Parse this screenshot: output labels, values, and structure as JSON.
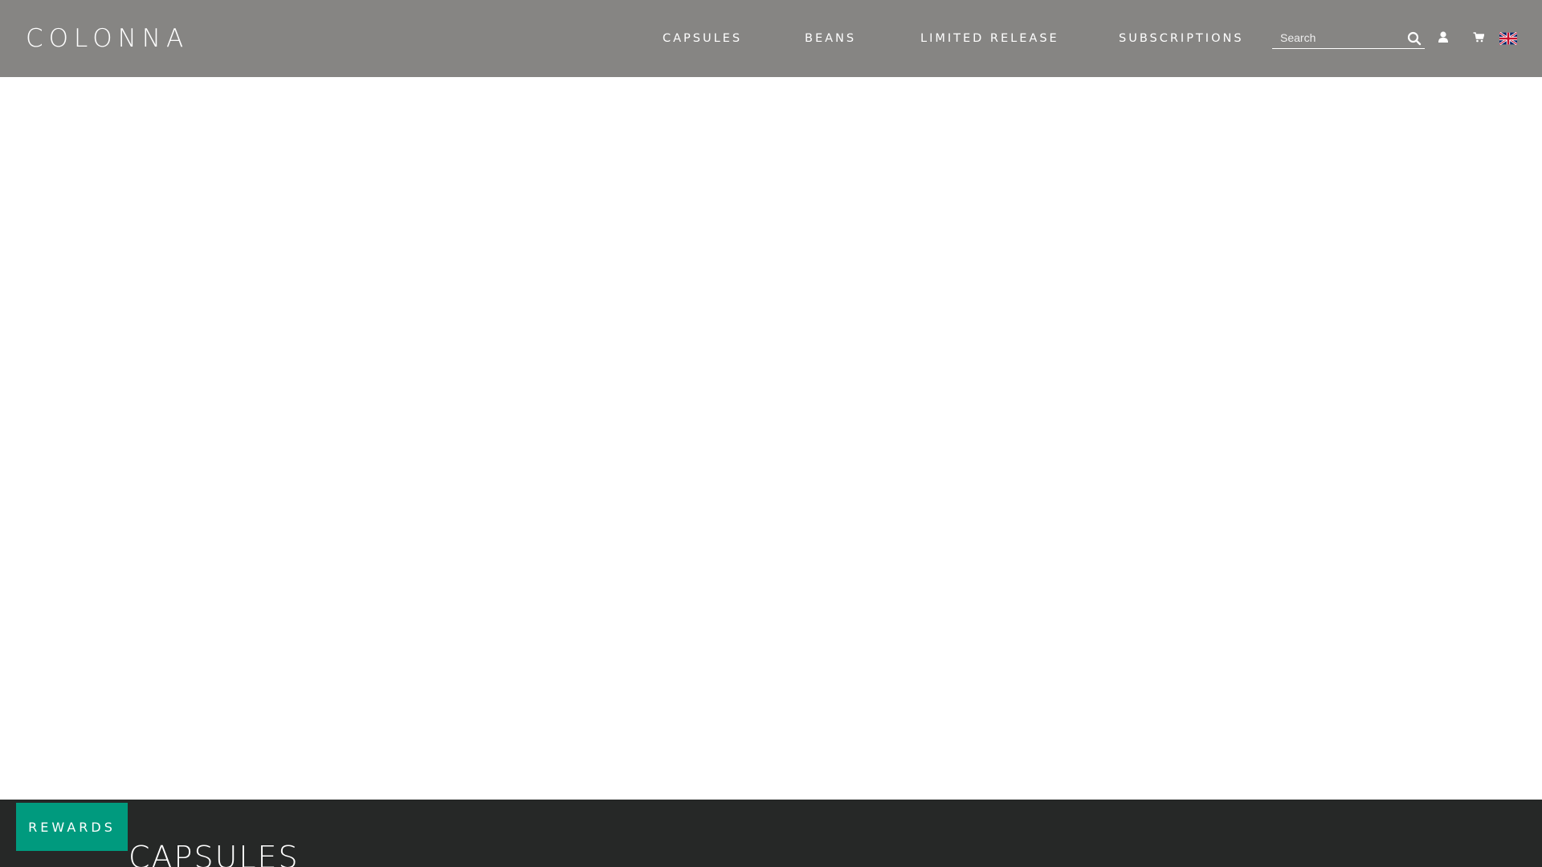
{
  "header": {
    "logo": "COLONNA",
    "nav": [
      {
        "label": "CAPSULES"
      },
      {
        "label": "BEANS"
      },
      {
        "label": "LIMITED RELEASE"
      },
      {
        "label": "SUBSCRIPTIONS"
      }
    ],
    "search": {
      "placeholder": "Search",
      "value": ""
    },
    "icons": {
      "search": "search-icon",
      "account": "user-icon",
      "cart": "cart-icon",
      "language": "uk-flag-icon"
    }
  },
  "rewards_button": {
    "label": "REWARDS"
  },
  "section": {
    "title": "CAPSULES"
  },
  "colors": {
    "header_bg": "#868583",
    "dark_section_bg": "#262827",
    "rewards_bg": "#009a7e"
  }
}
